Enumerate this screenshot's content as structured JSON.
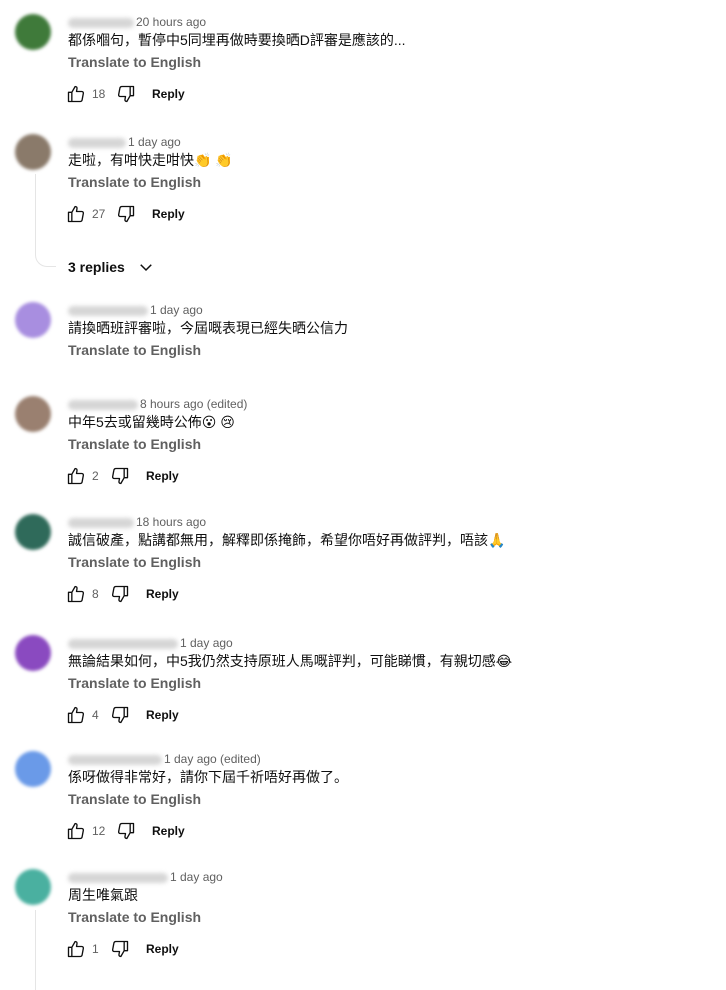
{
  "comments": [
    {
      "time": "20 hours ago",
      "text": "都係嗰句，暫停中5同埋再做時要換晒D評審是應該的...",
      "translate": "Translate to English",
      "likes": "18",
      "reply": "Reply",
      "avatar_color": "#3f7a3a"
    },
    {
      "time": "1 day ago",
      "text": "走啦，有咁快走咁快👏 👏",
      "translate": "Translate to English",
      "likes": "27",
      "reply": "Reply",
      "avatar_color": "#8a7a6a"
    },
    {
      "time": "1 day ago",
      "text": "請換晒班評審啦，今屆嘅表現已經失晒公信力",
      "translate": "Translate to English",
      "avatar_color": "#a88ee0"
    },
    {
      "time": "8 hours ago (edited)",
      "text": "中年5去或留幾時公佈😮 😢",
      "translate": "Translate to English",
      "likes": "2",
      "reply": "Reply",
      "avatar_color": "#9a8070"
    },
    {
      "time": "18 hours ago",
      "text": "誠信破產，點講都無用，解釋即係掩飾，希望你唔好再做評判，唔該🙏",
      "translate": "Translate to English",
      "likes": "8",
      "reply": "Reply",
      "avatar_color": "#2f6a5a"
    },
    {
      "time": "1 day ago",
      "text": "無論結果如何，中5我仍然支持原班人馬嘅評判，可能睇慣，有親切感😂",
      "translate": "Translate to English",
      "likes": "4",
      "reply": "Reply",
      "avatar_color": "#8a4ac0"
    },
    {
      "time": "1 day ago (edited)",
      "text": "係呀做得非常好，請你下屆千祈唔好再做了。",
      "translate": "Translate to English",
      "likes": "12",
      "reply": "Reply",
      "avatar_color": "#6a9ae8"
    },
    {
      "time": "1 day ago",
      "text": "周生唯氣跟",
      "translate": "Translate to English",
      "likes": "1",
      "reply": "Reply",
      "avatar_color": "#4ab0a0"
    }
  ],
  "replies_toggle": "3 replies",
  "icons": {
    "like": "thumbs-up-icon",
    "dislike": "thumbs-down-icon",
    "expand": "chevron-down-icon"
  }
}
